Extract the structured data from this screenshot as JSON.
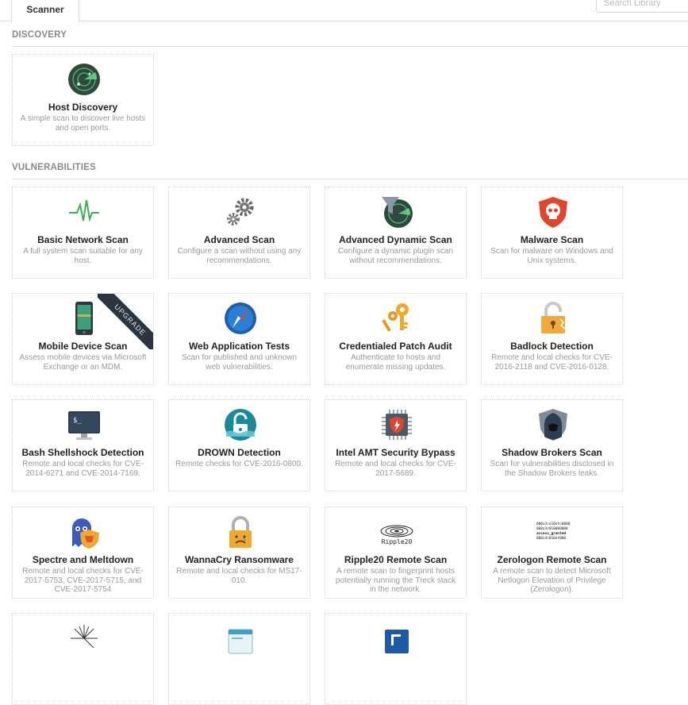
{
  "tabs": {
    "scanner": "Scanner"
  },
  "search": {
    "placeholder": "Search Library"
  },
  "sections": {
    "discovery": "DISCOVERY",
    "vulnerabilities": "VULNERABILITIES"
  },
  "discovery": [
    {
      "icon": "radar-icon",
      "name": "Host Discovery",
      "desc": "A simple scan to discover live hosts and open ports."
    }
  ],
  "vulns": [
    {
      "icon": "pulse-icon",
      "name": "Basic Network Scan",
      "desc": "A full system scan suitable for any host."
    },
    {
      "icon": "gears-icon",
      "name": "Advanced Scan",
      "desc": "Configure a scan without using any recommendations."
    },
    {
      "icon": "funnel-radar-icon",
      "name": "Advanced Dynamic Scan",
      "desc": "Configure a dynamic plugin scan without recommendations."
    },
    {
      "icon": "skull-shield-icon",
      "name": "Malware Scan",
      "desc": "Scan for malware on Windows and Unix systems."
    },
    {
      "icon": "mobile-device-icon",
      "name": "Mobile Device Scan",
      "desc": "Assess mobile devices via Microsoft Exchange or an MDM.",
      "ribbon": "UPGRADE"
    },
    {
      "icon": "compass-icon",
      "name": "Web Application Tests",
      "desc": "Scan for published and unknown web vulnerabilities."
    },
    {
      "icon": "keys-icon",
      "name": "Credentialed Patch Audit",
      "desc": "Authenticate to hosts and enumerate missing updates."
    },
    {
      "icon": "broken-padlock-icon",
      "name": "Badlock Detection",
      "desc": "Remote and local checks for CVE-2016-2118 and CVE-2016-0128."
    },
    {
      "icon": "terminal-monitor-icon",
      "name": "Bash Shellshock Detection",
      "desc": "Remote and local checks for CVE-2014-6271 and CVE-2014-7169."
    },
    {
      "icon": "drowning-padlock-icon",
      "name": "DROWN Detection",
      "desc": "Remote checks for CVE-2016-0800."
    },
    {
      "icon": "chip-icon",
      "name": "Intel AMT Security Bypass",
      "desc": "Remote and local checks for CVE-2017-5689."
    },
    {
      "icon": "hooded-figure-icon",
      "name": "Shadow Brokers Scan",
      "desc": "Scan for vulnerabilities disclosed in the Shadow Brokers leaks."
    },
    {
      "icon": "ghost-shield-icon",
      "name": "Spectre and Meltdown",
      "desc": "Remote and local checks for CVE-2017-5753, CVE-2017-5715, and CVE-2017-5754"
    },
    {
      "icon": "sad-padlock-icon",
      "name": "WannaCry Ransomware",
      "desc": "Remote and local checks for MS17-010."
    },
    {
      "icon": "ripple20-logo-icon",
      "name": "Ripple20 Remote Scan",
      "desc": "A remote scan to fingerprint hosts potentially running the Treck stack in the network."
    },
    {
      "icon": "zerologon-text-icon",
      "name": "Zerologon Remote Scan",
      "desc": "A remote scan to detect Microsoft Netlogon Elevation of Privilege (Zerologon)."
    },
    {
      "icon": "starburst-icon",
      "name": "",
      "desc": ""
    },
    {
      "icon": "document-icon",
      "name": "",
      "desc": ""
    },
    {
      "icon": "blue-box-icon",
      "name": "",
      "desc": ""
    }
  ],
  "ripple_logo_text": "Ripple20",
  "zerologon_logo_lines": [
    "000z3ro10ntc0000",
    "000z3r010000000",
    "access_granted",
    "000z3r010nt000"
  ],
  "colors": {
    "accent": "#00a0dc",
    "muted": "#9a9a9a",
    "rule": "#e0e0e0"
  }
}
